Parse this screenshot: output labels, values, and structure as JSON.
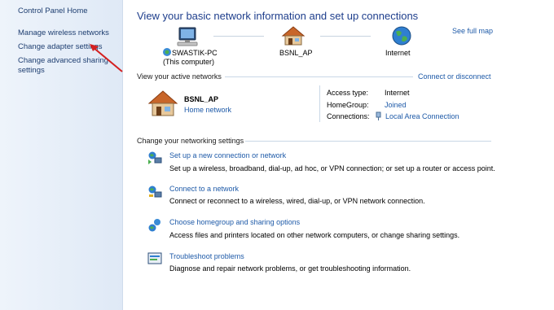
{
  "sidebar": {
    "home": "Control Panel Home",
    "items": [
      {
        "label": "Manage wireless networks"
      },
      {
        "label": "Change adapter settings"
      },
      {
        "label": "Change advanced sharing"
      },
      {
        "label": "settings"
      }
    ]
  },
  "header": {
    "title": "View your basic network information and set up connections"
  },
  "map": {
    "see_full_map": "See full map",
    "computer_name": "SWASTIK-PC",
    "computer_sub": "(This computer)",
    "network_name": "BSNL_AP",
    "internet_label": "Internet"
  },
  "active": {
    "heading": "View your active networks",
    "connect_link": "Connect or disconnect",
    "network_name": "BSNL_AP",
    "network_type": "Home network",
    "access_type_label": "Access type:",
    "access_type_value": "Internet",
    "homegroup_label": "HomeGroup:",
    "homegroup_value": "Joined",
    "connections_label": "Connections:",
    "connections_value": "Local Area Connection"
  },
  "settings": {
    "heading": "Change your networking settings",
    "items": [
      {
        "title": "Set up a new connection or network",
        "desc": "Set up a wireless, broadband, dial-up, ad hoc, or VPN connection; or set up a router or access point."
      },
      {
        "title": "Connect to a network",
        "desc": "Connect or reconnect to a wireless, wired, dial-up, or VPN network connection."
      },
      {
        "title": "Choose homegroup and sharing options",
        "desc": "Access files and printers located on other network computers, or change sharing settings."
      },
      {
        "title": "Troubleshoot problems",
        "desc": "Diagnose and repair network problems, or get troubleshooting information."
      }
    ]
  },
  "colors": {
    "link": "#1e5aa8",
    "title": "#1e3e8c",
    "arrow": "#d42020"
  }
}
